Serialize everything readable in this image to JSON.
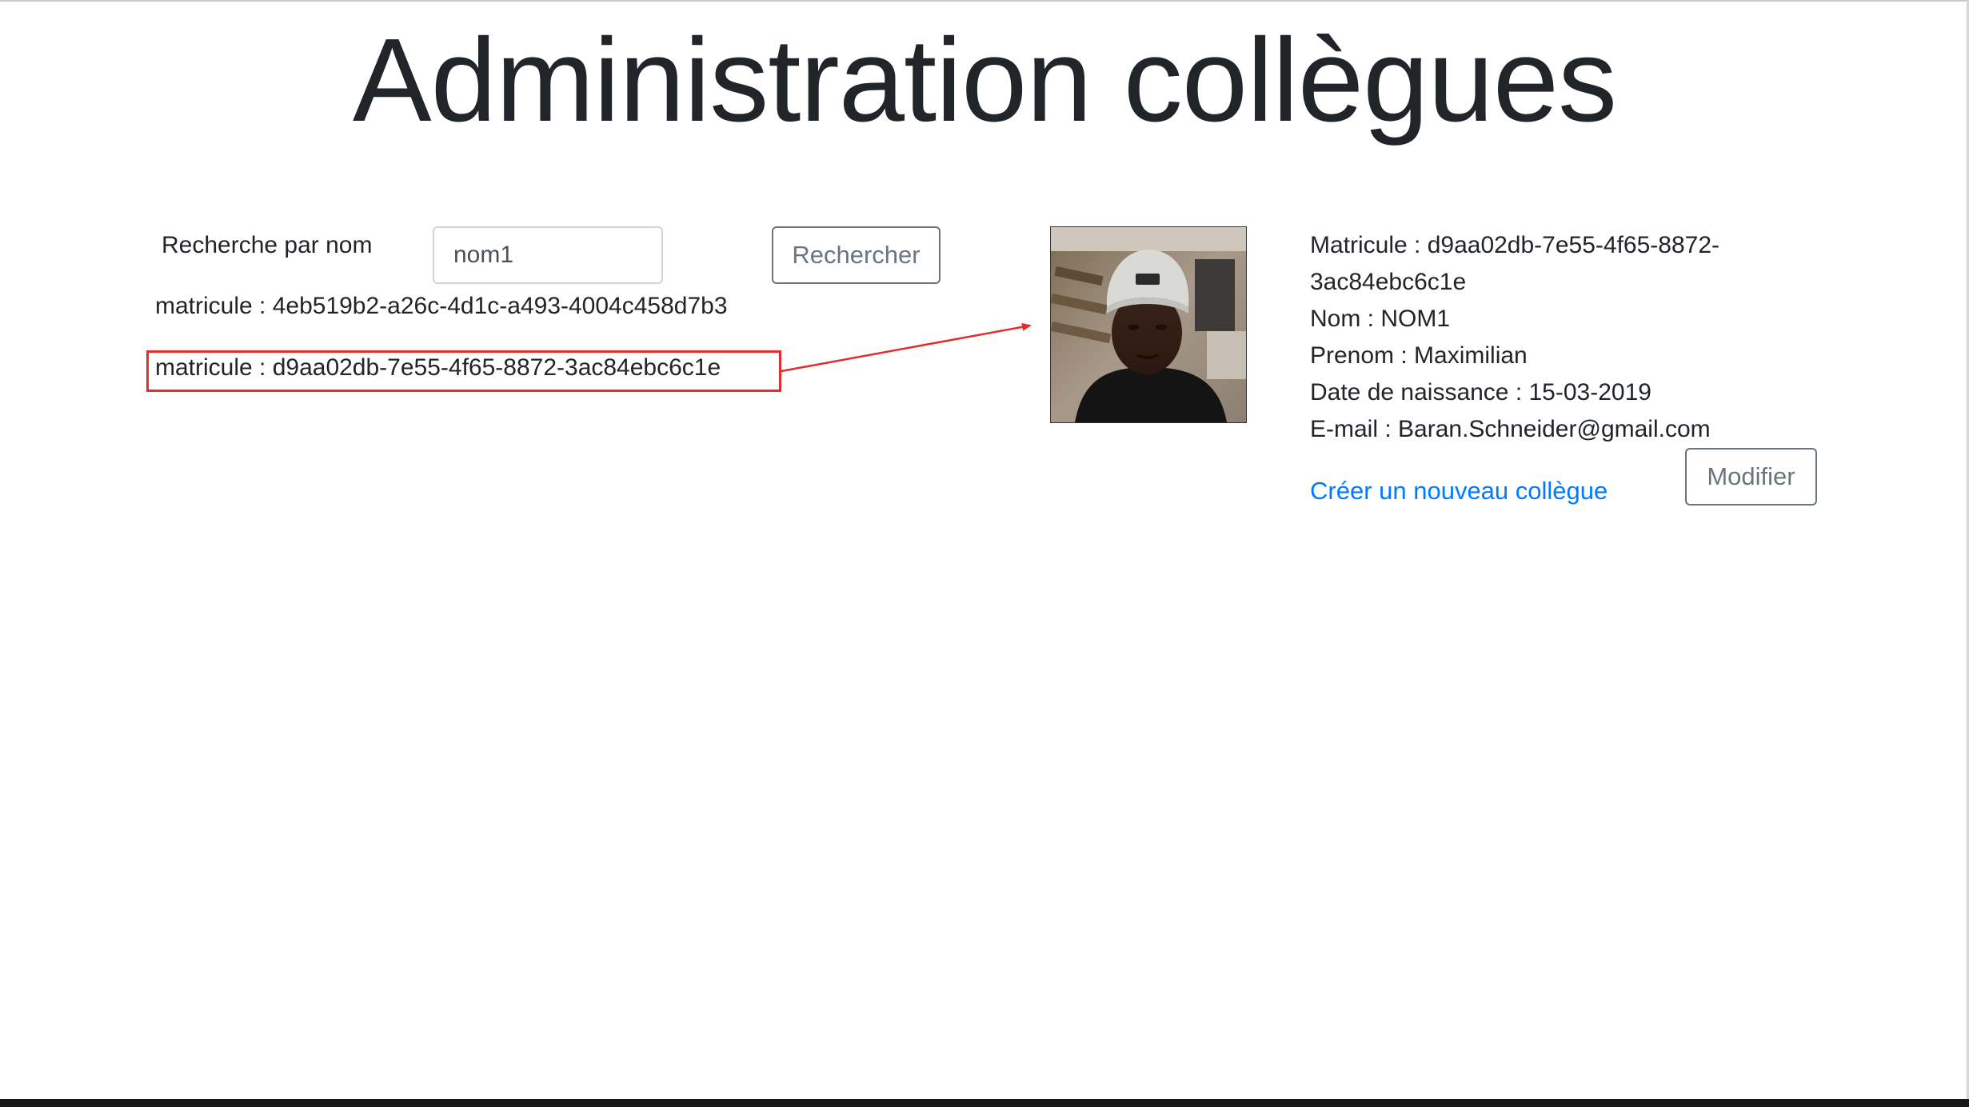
{
  "page": {
    "title": "Administration collègues"
  },
  "search": {
    "label": "Recherche par nom",
    "value": "nom1",
    "button_label": "Rechercher"
  },
  "results": [
    {
      "text": "matricule : 4eb519b2-a26c-4d1c-a493-4004c458d7b3"
    },
    {
      "text": "matricule : d9aa02db-7e55-4f65-8872-3ac84ebc6c1e",
      "highlighted": true
    }
  ],
  "detail": {
    "matricule": "Matricule : d9aa02db-7e55-4f65-8872-3ac84ebc6c1e",
    "nom": "Nom : NOM1",
    "prenom": "Prenom : Maximilian",
    "date_naissance": "Date de naissance : 15-03-2019",
    "email": "E-mail : Baran.Schneider@gmail.com",
    "create_link": "Créer un nouveau collègue",
    "modify_label": "Modifier"
  },
  "colors": {
    "annotation": "#e32d2d",
    "link": "#007bff",
    "button_outline": "#6c757d",
    "text": "#212529"
  }
}
